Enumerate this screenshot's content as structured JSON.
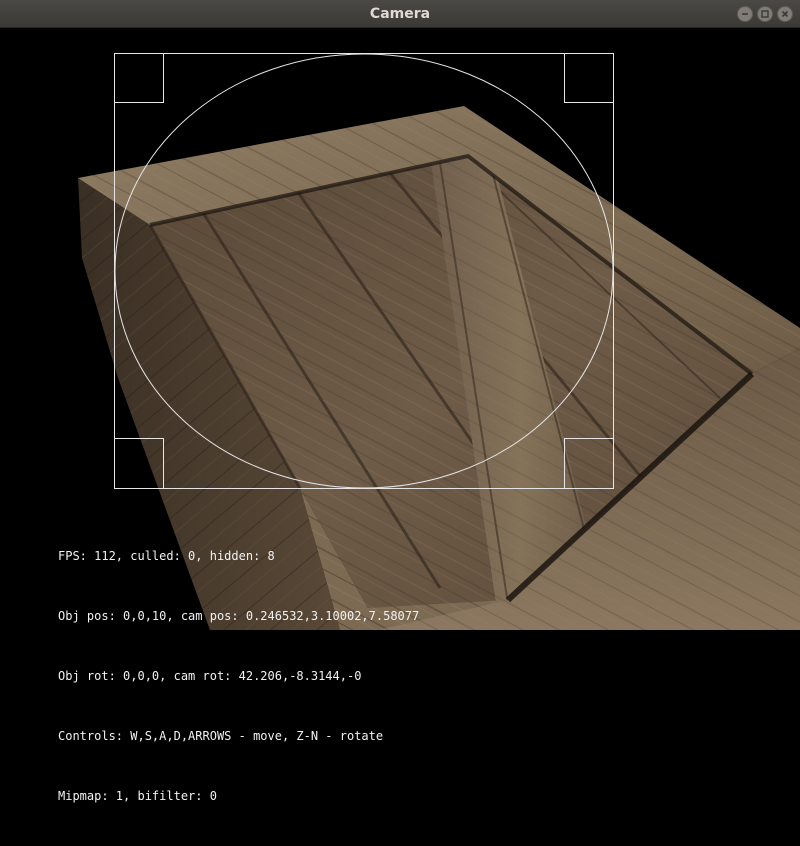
{
  "window": {
    "title": "Camera",
    "buttons": [
      "minimize-icon",
      "maximize-icon",
      "close-icon"
    ]
  },
  "colors": {
    "background": "#000000",
    "hud_text": "#f2f2f2",
    "overlay_lines": "#e6e6e6",
    "crate_wood": "#6e5a44"
  },
  "hud": {
    "fps_line": "FPS: 112, culled: 0, hidden: 8",
    "pos_line": "Obj pos: 0,0,10, cam pos: 0.246532,3.10002,7.58077",
    "rot_line": "Obj rot: 0,0,0, cam rot: 42.206,-8.3144,-0",
    "controls_line": "Controls: W,S,A,D,ARROWS - move, Z-N - rotate",
    "mipmap_line": "Mipmap: 1, bifilter: 0"
  }
}
